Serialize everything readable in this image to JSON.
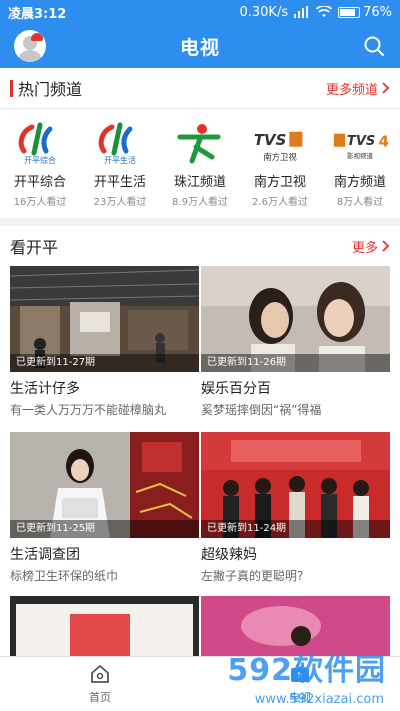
{
  "status": {
    "time": "凌晨3:12",
    "speed": "0.30K/s",
    "battery": "76%"
  },
  "header": {
    "title": "电视"
  },
  "hot": {
    "title": "热门频道",
    "more": "更多频道",
    "channels": [
      {
        "name": "开平综合",
        "views": "16万人看过"
      },
      {
        "name": "开平生活",
        "views": "23万人看过"
      },
      {
        "name": "珠江频道",
        "views": "8.9万人看过"
      },
      {
        "name": "南方卫视",
        "views": "2.6万人看过"
      },
      {
        "name": "南方频道",
        "views": "8万人看过"
      }
    ]
  },
  "kp": {
    "title": "看开平",
    "more": "更多",
    "cards": [
      {
        "badge": "已更新到11-27期",
        "title": "生活计仔多",
        "sub": "有一类人万万万不能碰樟脑丸"
      },
      {
        "badge": "已更新到11-26期",
        "title": "娱乐百分百",
        "sub": "奚梦瑶摔倒因“祸”得福"
      },
      {
        "badge": "已更新到11-25期",
        "title": "生活调查团",
        "sub": "标榜卫生环保的纸巾"
      },
      {
        "badge": "已更新到11-24期",
        "title": "超级辣妈",
        "sub": "左撇子真的更聪明?"
      }
    ]
  },
  "nav": {
    "home": "首页",
    "tv": "电视"
  },
  "watermark": {
    "big": "592软件园",
    "small": "www.592xiazai.com"
  },
  "colors": {
    "brand": "#2e8ef0",
    "accent": "#e5322e"
  }
}
